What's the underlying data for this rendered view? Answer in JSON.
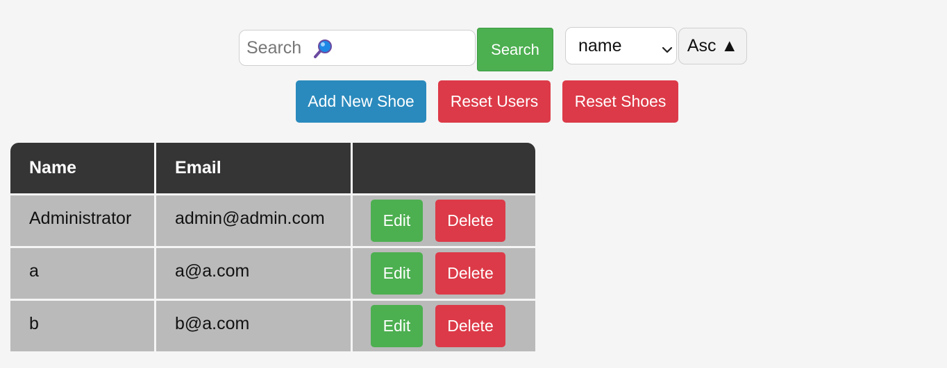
{
  "search": {
    "placeholder": "Search",
    "value": "",
    "icon": "magnifying-glass-icon",
    "button_label": "Search"
  },
  "sort": {
    "selected": "name",
    "order_label": "Asc ▲"
  },
  "actions": {
    "add_shoe_label": "Add New Shoe",
    "reset_users_label": "Reset Users",
    "reset_shoes_label": "Reset Shoes"
  },
  "table": {
    "headers": [
      "Name",
      "Email",
      ""
    ],
    "rows": [
      {
        "name": "Administrator",
        "email": "admin@admin.com",
        "edit_label": "Edit",
        "delete_label": "Delete"
      },
      {
        "name": "a",
        "email": "a@a.com",
        "edit_label": "Edit",
        "delete_label": "Delete"
      },
      {
        "name": "b",
        "email": "b@a.com",
        "edit_label": "Edit",
        "delete_label": "Delete"
      }
    ]
  },
  "colors": {
    "page_background": "#f5f5f5",
    "search_button": "#4caf50",
    "add_button": "#2a8abd",
    "danger_button": "#dc3a48",
    "table_header": "#353535",
    "table_row": "#bababa"
  }
}
